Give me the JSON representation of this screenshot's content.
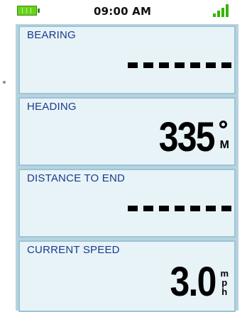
{
  "status_bar": {
    "time": "09:00 AM",
    "battery_icon": "battery-full-icon",
    "signal_icon": "signal-strength-icon",
    "accent_color": "#37b500"
  },
  "tiles": [
    {
      "label": "BEARING",
      "value": "-------",
      "unit": ""
    },
    {
      "label": "HEADING",
      "value": "335",
      "unit": "M"
    },
    {
      "label": "DISTANCE TO END",
      "value": "-------",
      "unit": ""
    },
    {
      "label": "CURRENT SPEED",
      "value": "3.0",
      "unit_letters": [
        "m",
        "p",
        "h"
      ]
    }
  ],
  "colors": {
    "tile_background": "#e8f3f8",
    "tile_border": "#9cc4d6",
    "label_color": "#1a3b8c"
  }
}
